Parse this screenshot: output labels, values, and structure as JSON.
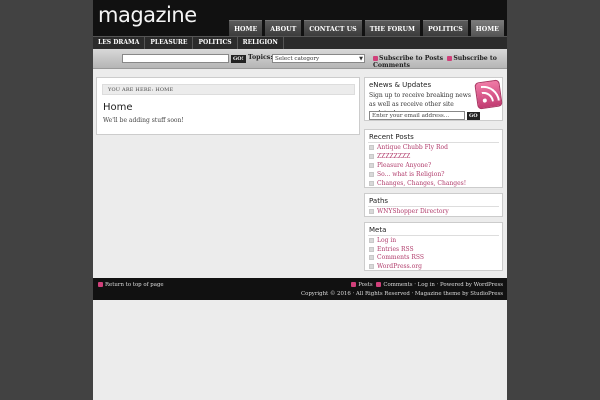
{
  "header": {
    "logo": "magazine",
    "nav": [
      "HOME",
      "ABOUT",
      "CONTACT US",
      "THE FORUM",
      "POLITICS",
      "HOME"
    ],
    "subnav": [
      "LES DRAMA",
      "PLEASURE",
      "POLITICS",
      "RELIGION"
    ]
  },
  "searchbar": {
    "go_label": "GO!",
    "topics_label": "Topics:",
    "topics_selected": "Select category",
    "subscribe_posts": "Subscribe to Posts",
    "subscribe_comments": "Subscribe to Comments"
  },
  "main": {
    "breadcrumb": "YOU ARE HERE: HOME",
    "title": "Home",
    "body": "We'll be adding stuff soon!"
  },
  "sidebar": {
    "enews": {
      "title": "eNews & Updates",
      "text": "Sign up to receive breaking news as well as receive other site updates!",
      "email_placeholder": "Enter your email address...",
      "go_label": "GO"
    },
    "recent_posts": {
      "title": "Recent Posts",
      "items": [
        "Antique Chubb Fly Rod",
        "ZZZZZZZZ",
        "Pleasure Anyone?",
        "So... what is Religion?",
        "Changes, Changes, Changes!"
      ]
    },
    "paths": {
      "title": "Paths",
      "items": [
        "WNYShopper Directory"
      ]
    },
    "meta": {
      "title": "Meta",
      "items": [
        "Log in",
        "Entries RSS",
        "Comments RSS",
        "WordPress.org"
      ]
    }
  },
  "footer": {
    "return_top": "Return to top of page",
    "posts": "Posts",
    "comments": "Comments",
    "links_text": " · Log in · Powered by WordPress",
    "copyright": "Copyright © 2016 · All Rights Reserved · Magazine theme by StudioPress"
  },
  "colors": {
    "accent": "#b03a6a",
    "rss": "#d0407a",
    "header_bg": "#111111",
    "page_bg": "#424242"
  }
}
